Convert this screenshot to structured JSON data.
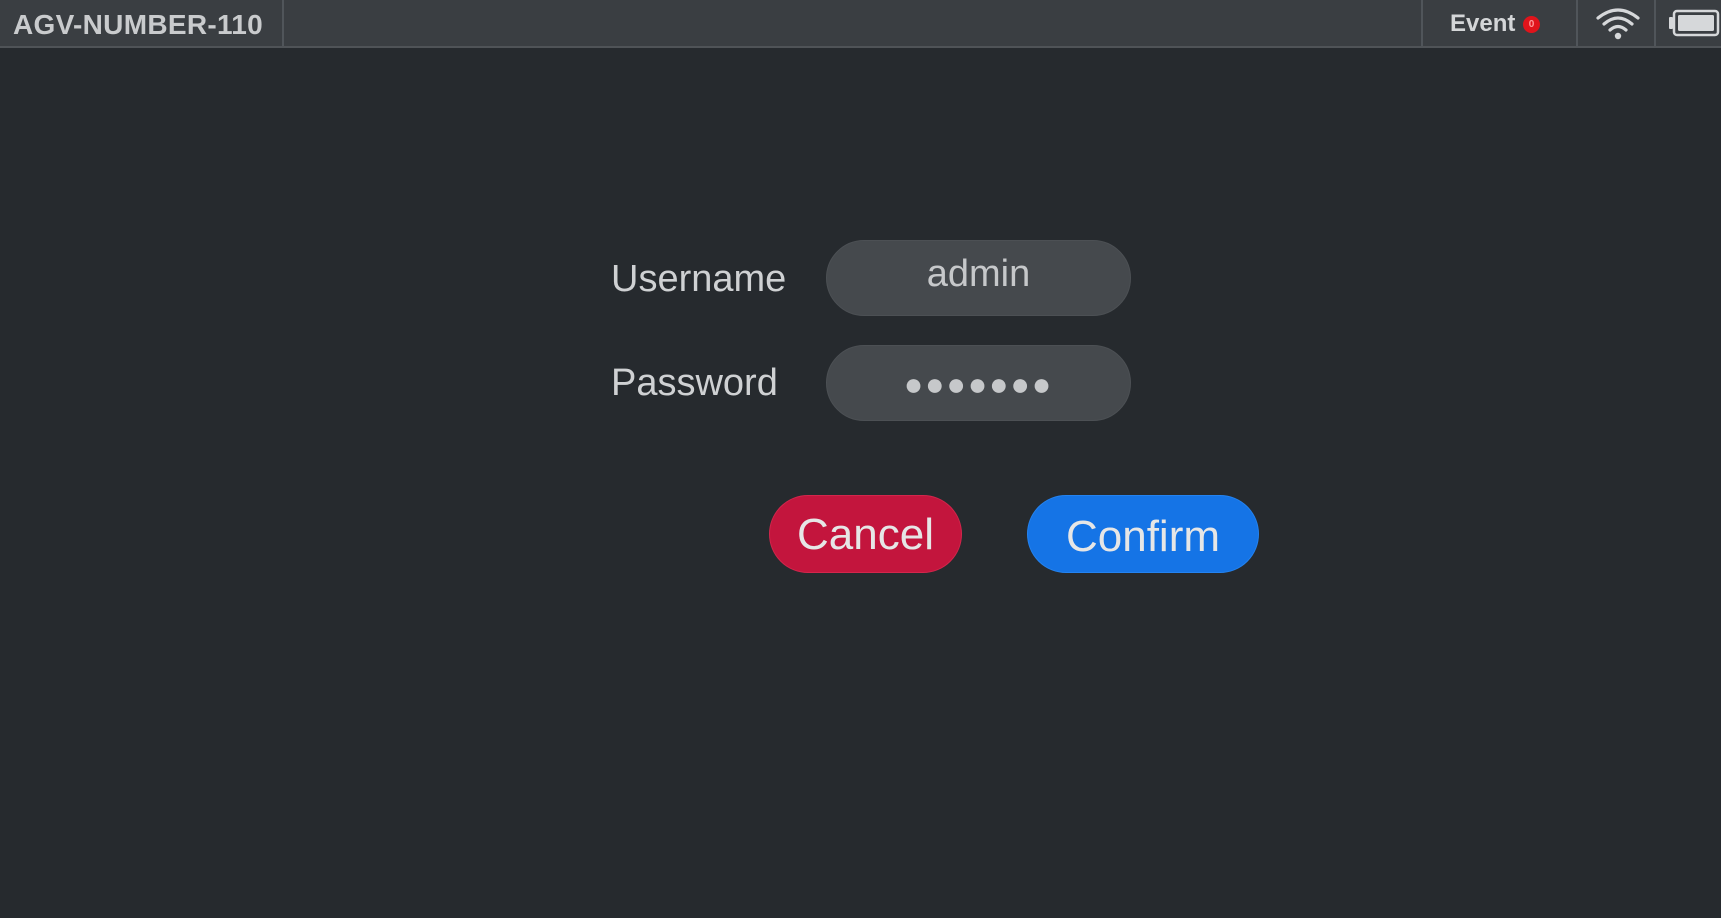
{
  "header": {
    "device_name": "AGV-NUMBER-110",
    "event_label": "Event",
    "event_count": "0",
    "wifi_icon": "wifi-icon",
    "battery_icon": "battery-icon"
  },
  "login": {
    "username_label": "Username",
    "username_value": "admin",
    "password_label": "Password",
    "password_value": "●●●●●●●",
    "cancel_label": "Cancel",
    "confirm_label": "Confirm"
  },
  "colors": {
    "background": "#262a2e",
    "topbar": "#3a3e42",
    "cancel": "#c3153d",
    "confirm": "#1574e6",
    "badge": "#e0141b"
  }
}
